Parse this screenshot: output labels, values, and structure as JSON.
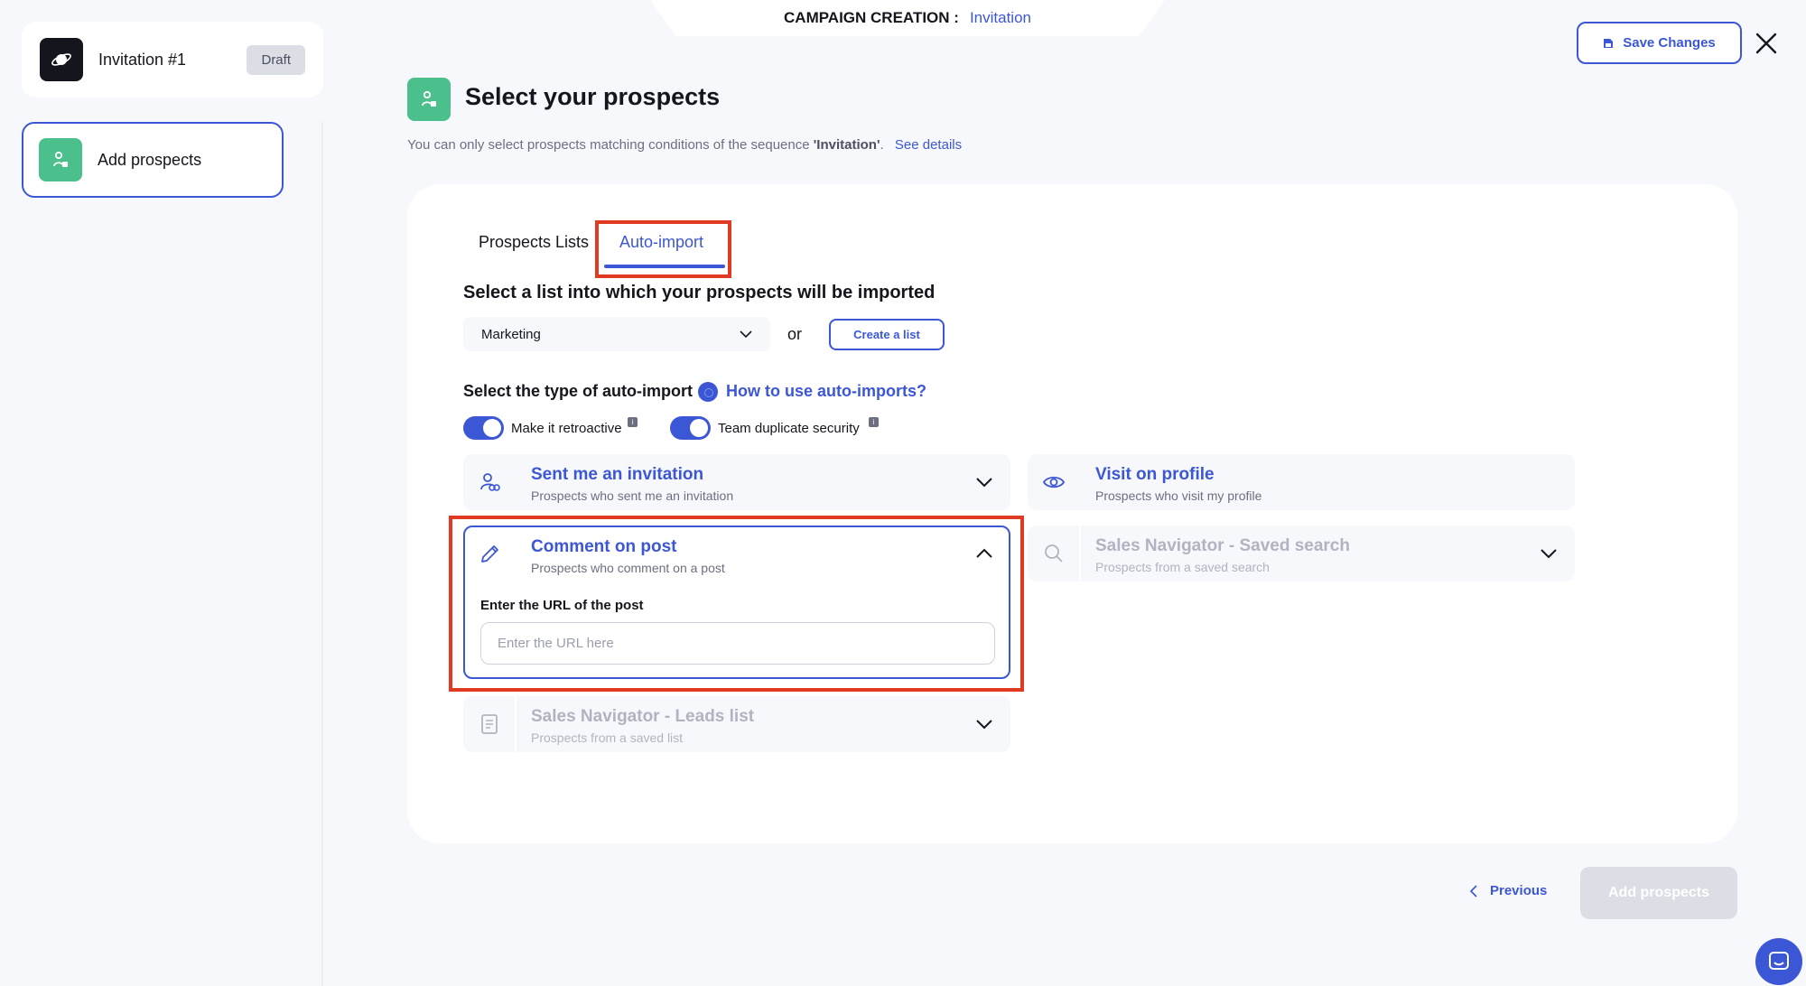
{
  "header": {
    "title": "CAMPAIGN CREATION :",
    "campaign_type": "Invitation",
    "save_label": "Save Changes"
  },
  "sidebar": {
    "campaign_name": "Invitation #1",
    "status": "Draft",
    "steps": [
      {
        "label": "Add prospects"
      }
    ]
  },
  "page": {
    "title": "Select your prospects",
    "subtitle_prefix": "You can only select prospects matching conditions of the sequence ",
    "subtitle_sequence": "'Invitation'",
    "subtitle_suffix": ".",
    "details_link": "See details"
  },
  "tabs": [
    {
      "label": "Prospects Lists",
      "active": false
    },
    {
      "label": "Auto-import",
      "active": true
    }
  ],
  "list_section": {
    "title": "Select a list into which your prospects will be imported",
    "selected_list": "Marketing",
    "or_label": "or",
    "create_label": "Create a list"
  },
  "auto_import": {
    "title": "Select the type of auto-import",
    "help_link": "How to use auto-imports?",
    "toggles": [
      {
        "label": "Make it retroactive",
        "on": true
      },
      {
        "label": "Team duplicate security",
        "on": true
      }
    ],
    "info_glyph": "i"
  },
  "options": {
    "sent_invitation": {
      "title": "Sent me an invitation",
      "subtitle": "Prospects who sent me an invitation",
      "icon": "user-link-icon"
    },
    "visit_profile": {
      "title": "Visit on profile",
      "subtitle": "Prospects who visit my profile",
      "icon": "eye-icon"
    },
    "comment_post": {
      "title": "Comment on post",
      "subtitle": "Prospects who comment on a post",
      "icon": "pencil-icon",
      "url_label": "Enter the URL of the post",
      "url_placeholder": "Enter the URL here",
      "url_value": ""
    },
    "sales_nav_search": {
      "title": "Sales Navigator - Saved search",
      "subtitle": "Prospects from a saved search",
      "icon": "search-icon",
      "disabled": true
    },
    "sales_nav_leads": {
      "title": "Sales Navigator - Leads list",
      "subtitle": "Prospects from a saved list",
      "icon": "document-icon",
      "disabled": true
    }
  },
  "footer": {
    "previous_label": "Previous",
    "add_label": "Add prospects"
  },
  "colors": {
    "accent": "#3c57d6",
    "success": "#4bbf8c",
    "highlight": "#e03a22",
    "disabled": "#dcdee6"
  }
}
